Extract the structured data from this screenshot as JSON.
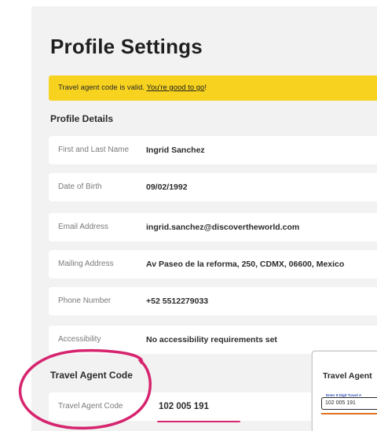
{
  "page": {
    "title": "Profile Settings"
  },
  "banner": {
    "text_before": "Travel agent code is valid. ",
    "link_text": "You're good to go",
    "text_after": "!"
  },
  "profile_details": {
    "heading": "Profile Details",
    "rows": [
      {
        "label": "First and Last Name",
        "value": "Ingrid Sanchez"
      },
      {
        "label": "Date of Birth",
        "value": "09/02/1992"
      },
      {
        "label": "Email Address",
        "value": "ingrid.sanchez@discovertheworld.com"
      },
      {
        "label": "Mailing Address",
        "value": "Av Paseo de la reforma, 250, CDMX, 06600, Mexico"
      },
      {
        "label": "Phone Number",
        "value": "+52 5512279033"
      },
      {
        "label": "Accessibility",
        "value": "No accessibility requirements set"
      }
    ]
  },
  "travel_agent": {
    "heading": "Travel Agent Code",
    "label": "Travel Agent Code",
    "value": "102 005 191"
  },
  "inset_card": {
    "title": "Travel Agent",
    "field_label": "Enter 9 Digit Travel A",
    "field_value": "102 005 191"
  },
  "colors": {
    "banner": "#f7d21f",
    "annotation": "#d6246e",
    "inset_underline": "#e2731f",
    "panel_bg": "#f2f2f2"
  }
}
